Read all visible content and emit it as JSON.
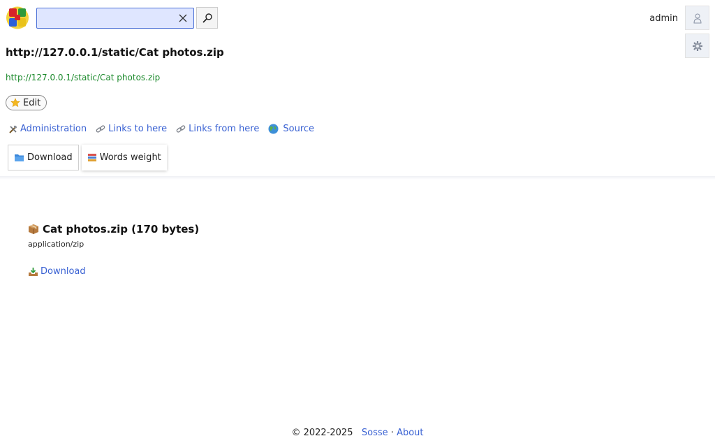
{
  "header": {
    "search": {
      "value": "",
      "placeholder": ""
    },
    "user": {
      "name": "admin"
    }
  },
  "document": {
    "title": "http://127.0.0.1/static/Cat photos.zip",
    "url": "http://127.0.0.1/static/Cat photos.zip",
    "edit_label": "Edit"
  },
  "nav": {
    "administration": "Administration",
    "links_to_here": "Links to here",
    "links_from_here": "Links from here",
    "source": "Source"
  },
  "tabs": {
    "download": "Download",
    "words_weight": "Words weight"
  },
  "content": {
    "file_title": "Cat photos.zip (170 bytes)",
    "mime": "application/zip",
    "download_label": "Download"
  },
  "footer": {
    "copyright": "© 2022-2025",
    "sosse_link": "Sosse",
    "separator": "·",
    "about_link": "About"
  },
  "icons": {
    "logo": "sosse-logo-icon",
    "clear": "close-icon",
    "search": "magnifier-icon",
    "user": "user-icon",
    "settings": "gear-icon",
    "edit": "star-icon",
    "administration": "tools-icon",
    "links_to": "link-icon",
    "links_from": "link-icon",
    "source": "globe-icon",
    "download_tab": "folder-icon",
    "words_weight": "books-icon",
    "file": "package-icon",
    "download": "download-tray-icon"
  }
}
